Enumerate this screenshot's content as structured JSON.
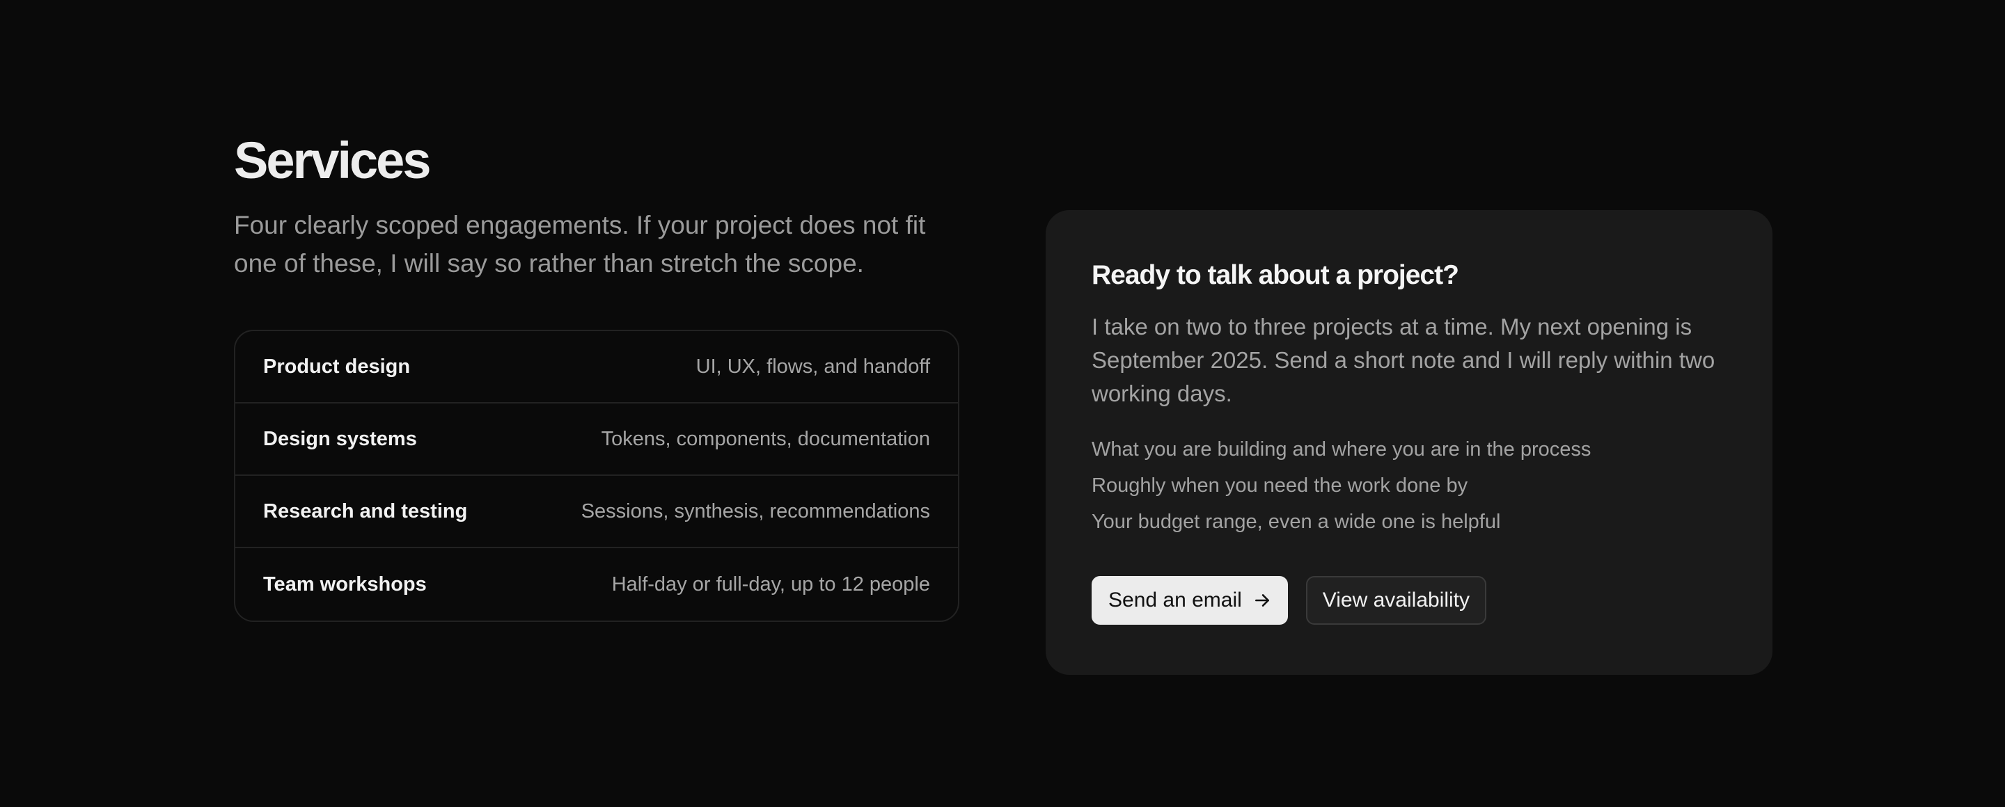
{
  "services_section": {
    "title": "Services",
    "lede": "Four clearly scoped engagements. If your project does not fit one of these, I will say so rather than stretch the scope.",
    "items": [
      {
        "name": "Product design",
        "detail": "UI, UX, flows, and handoff"
      },
      {
        "name": "Design systems",
        "detail": "Tokens, components, documentation"
      },
      {
        "name": "Research and testing",
        "detail": "Sessions, synthesis, recommendations"
      },
      {
        "name": "Team workshops",
        "detail": "Half-day or full-day, up to 12 people"
      }
    ]
  },
  "contact_card": {
    "title": "Ready to talk about a project?",
    "body": "I take on two to three projects at a time. My next opening is September 2025. Send a short note and I will reply within two working days.",
    "checklist": [
      "What you are building and where you are in the process",
      "Roughly when you need the work done by",
      "Your budget range, even a wide one is helpful"
    ],
    "primary_button": {
      "label": "Send an email",
      "icon": "arrow-right-icon"
    },
    "secondary_button": {
      "label": "View availability"
    }
  }
}
